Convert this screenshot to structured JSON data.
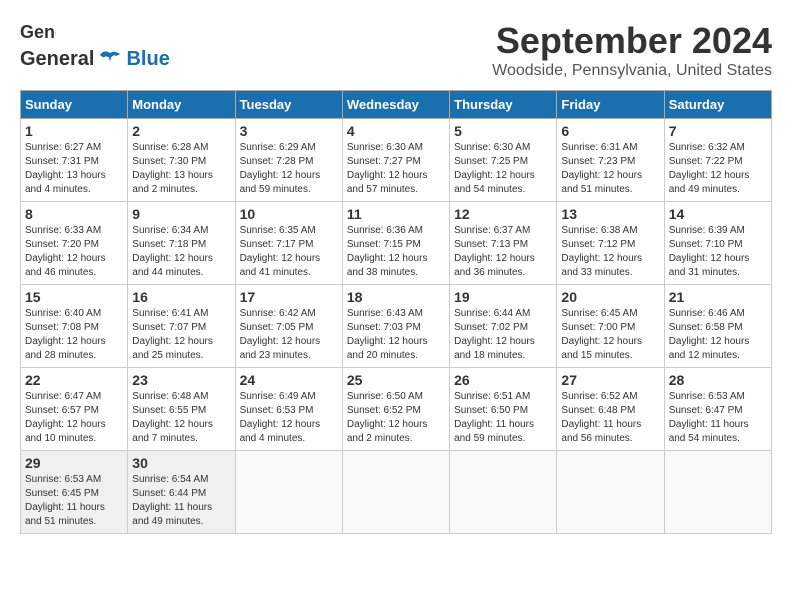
{
  "header": {
    "logo_general": "General",
    "logo_blue": "Blue",
    "month": "September 2024",
    "location": "Woodside, Pennsylvania, United States"
  },
  "weekdays": [
    "Sunday",
    "Monday",
    "Tuesday",
    "Wednesday",
    "Thursday",
    "Friday",
    "Saturday"
  ],
  "weeks": [
    [
      {
        "day": "1",
        "sunrise": "6:27 AM",
        "sunset": "7:31 PM",
        "daylight": "13 hours and 4 minutes."
      },
      {
        "day": "2",
        "sunrise": "6:28 AM",
        "sunset": "7:30 PM",
        "daylight": "13 hours and 2 minutes."
      },
      {
        "day": "3",
        "sunrise": "6:29 AM",
        "sunset": "7:28 PM",
        "daylight": "12 hours and 59 minutes."
      },
      {
        "day": "4",
        "sunrise": "6:30 AM",
        "sunset": "7:27 PM",
        "daylight": "12 hours and 57 minutes."
      },
      {
        "day": "5",
        "sunrise": "6:30 AM",
        "sunset": "7:25 PM",
        "daylight": "12 hours and 54 minutes."
      },
      {
        "day": "6",
        "sunrise": "6:31 AM",
        "sunset": "7:23 PM",
        "daylight": "12 hours and 51 minutes."
      },
      {
        "day": "7",
        "sunrise": "6:32 AM",
        "sunset": "7:22 PM",
        "daylight": "12 hours and 49 minutes."
      }
    ],
    [
      {
        "day": "8",
        "sunrise": "6:33 AM",
        "sunset": "7:20 PM",
        "daylight": "12 hours and 46 minutes."
      },
      {
        "day": "9",
        "sunrise": "6:34 AM",
        "sunset": "7:18 PM",
        "daylight": "12 hours and 44 minutes."
      },
      {
        "day": "10",
        "sunrise": "6:35 AM",
        "sunset": "7:17 PM",
        "daylight": "12 hours and 41 minutes."
      },
      {
        "day": "11",
        "sunrise": "6:36 AM",
        "sunset": "7:15 PM",
        "daylight": "12 hours and 38 minutes."
      },
      {
        "day": "12",
        "sunrise": "6:37 AM",
        "sunset": "7:13 PM",
        "daylight": "12 hours and 36 minutes."
      },
      {
        "day": "13",
        "sunrise": "6:38 AM",
        "sunset": "7:12 PM",
        "daylight": "12 hours and 33 minutes."
      },
      {
        "day": "14",
        "sunrise": "6:39 AM",
        "sunset": "7:10 PM",
        "daylight": "12 hours and 31 minutes."
      }
    ],
    [
      {
        "day": "15",
        "sunrise": "6:40 AM",
        "sunset": "7:08 PM",
        "daylight": "12 hours and 28 minutes."
      },
      {
        "day": "16",
        "sunrise": "6:41 AM",
        "sunset": "7:07 PM",
        "daylight": "12 hours and 25 minutes."
      },
      {
        "day": "17",
        "sunrise": "6:42 AM",
        "sunset": "7:05 PM",
        "daylight": "12 hours and 23 minutes."
      },
      {
        "day": "18",
        "sunrise": "6:43 AM",
        "sunset": "7:03 PM",
        "daylight": "12 hours and 20 minutes."
      },
      {
        "day": "19",
        "sunrise": "6:44 AM",
        "sunset": "7:02 PM",
        "daylight": "12 hours and 18 minutes."
      },
      {
        "day": "20",
        "sunrise": "6:45 AM",
        "sunset": "7:00 PM",
        "daylight": "12 hours and 15 minutes."
      },
      {
        "day": "21",
        "sunrise": "6:46 AM",
        "sunset": "6:58 PM",
        "daylight": "12 hours and 12 minutes."
      }
    ],
    [
      {
        "day": "22",
        "sunrise": "6:47 AM",
        "sunset": "6:57 PM",
        "daylight": "12 hours and 10 minutes."
      },
      {
        "day": "23",
        "sunrise": "6:48 AM",
        "sunset": "6:55 PM",
        "daylight": "12 hours and 7 minutes."
      },
      {
        "day": "24",
        "sunrise": "6:49 AM",
        "sunset": "6:53 PM",
        "daylight": "12 hours and 4 minutes."
      },
      {
        "day": "25",
        "sunrise": "6:50 AM",
        "sunset": "6:52 PM",
        "daylight": "12 hours and 2 minutes."
      },
      {
        "day": "26",
        "sunrise": "6:51 AM",
        "sunset": "6:50 PM",
        "daylight": "11 hours and 59 minutes."
      },
      {
        "day": "27",
        "sunrise": "6:52 AM",
        "sunset": "6:48 PM",
        "daylight": "11 hours and 56 minutes."
      },
      {
        "day": "28",
        "sunrise": "6:53 AM",
        "sunset": "6:47 PM",
        "daylight": "11 hours and 54 minutes."
      }
    ],
    [
      {
        "day": "29",
        "sunrise": "6:53 AM",
        "sunset": "6:45 PM",
        "daylight": "11 hours and 51 minutes."
      },
      {
        "day": "30",
        "sunrise": "6:54 AM",
        "sunset": "6:44 PM",
        "daylight": "11 hours and 49 minutes."
      },
      null,
      null,
      null,
      null,
      null
    ]
  ],
  "labels": {
    "sunrise": "Sunrise:",
    "sunset": "Sunset:",
    "daylight": "Daylight:"
  }
}
